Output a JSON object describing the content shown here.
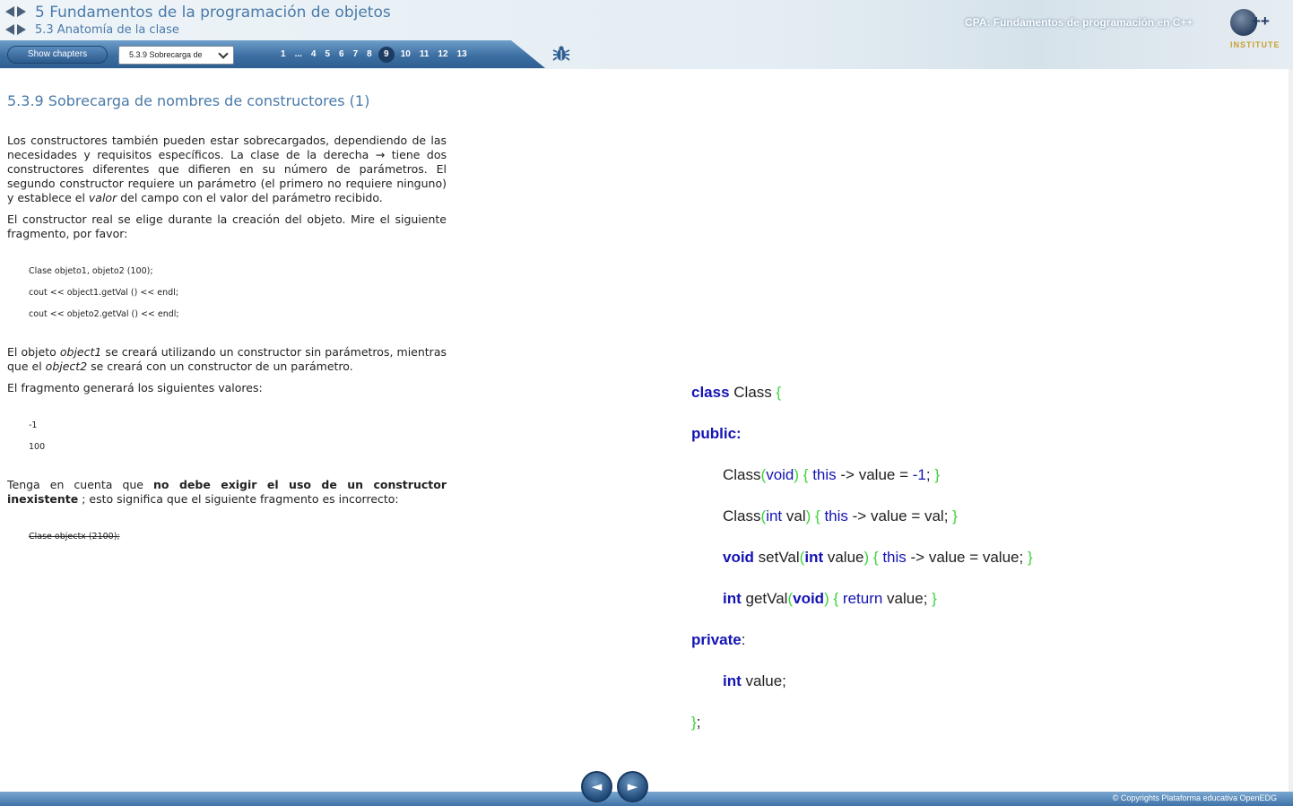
{
  "header": {
    "chapter_title": "5 Fundamentos de la programación de objetos",
    "section_title": "5.3 Anatomía de la clase",
    "course_title": "CPA: Fundamentos de programación en C++",
    "logo_symbol": "++",
    "logo_text": "INSTITUTE"
  },
  "toolbar": {
    "show_chapters_label": "Show chapters",
    "chapter_select_value": "5.3.9 Sobrecarga de",
    "pages": [
      "1",
      "...",
      "4",
      "5",
      "6",
      "7",
      "8",
      "9",
      "10",
      "11",
      "12",
      "13"
    ],
    "current_page": "9"
  },
  "content": {
    "heading": "5.3.9 Sobrecarga de nombres de constructores (1)",
    "para1": "Los constructores también pueden estar sobrecargados, dependiendo de las necesidades y requisitos específicos. La clase de la derecha → tiene dos constructores diferentes que difieren en su número de parámetros. El segundo constructor requiere un parámetro (el primero no requiere ninguno) y establece el ",
    "para1_italic": "valor",
    "para1_end": " del campo con el valor del parámetro recibido.",
    "para2": "El constructor real se elige durante la creación del objeto. Mire el siguiente fragmento, por favor:",
    "snippet1": [
      "Clase objeto1, objeto2 (100);",
      "cout << object1.getVal () << endl;",
      "cout << objeto2.getVal () << endl;"
    ],
    "para3_a": "El objeto ",
    "para3_italic1": "object1",
    "para3_b": " se creará utilizando un constructor sin parámetros, mientras que el ",
    "para3_italic2": "object2",
    "para3_c": " se creará con un constructor de un parámetro.",
    "para4": "El fragmento generará los siguientes valores:",
    "output": [
      "-1",
      "100"
    ],
    "para5_a": "Tenga en cuenta que ",
    "para5_bold": "no debe exigir el uso de un constructor inexistente",
    "para5_b": " ; esto significa que el siguiente fragmento es incorrecto:",
    "snippet2": "Clase objectx (2100);"
  },
  "code": {
    "lines": [
      "class Class {",
      "public:",
      "Class(void) { this -> value = -1; }",
      "Class(int val) { this -> value = val; }",
      "void setVal(int value) { this -> value = value; }",
      "int getVal(void) { return value; }",
      "private:",
      "int value;",
      "};"
    ]
  },
  "footer": {
    "copyright": "© Copyrights Plataforma educativa OpenEDG",
    "prev_label": "◄",
    "next_label": "►"
  },
  "colors": {
    "heading": "#4a7aa8",
    "keyword": "#1414b4",
    "bracket": "#3ad43a",
    "toolbar": "#3d6fa3"
  }
}
